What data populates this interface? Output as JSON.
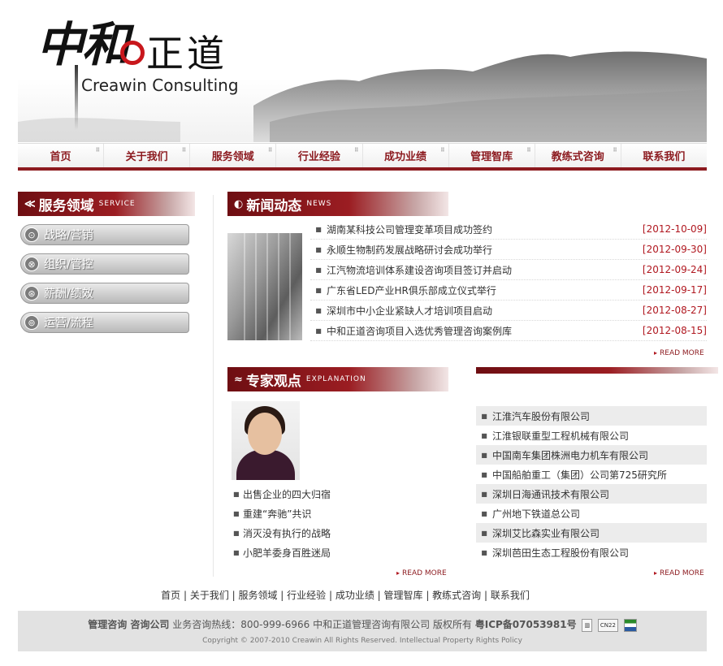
{
  "header": {
    "logo_cn_calligraphy": "中和",
    "logo_cn_text": "正道",
    "logo_en": "Creawin Consulting"
  },
  "nav": [
    "首页",
    "关于我们",
    "服务领域",
    "行业经验",
    "成功业绩",
    "管理智库",
    "教练式咨询",
    "联系我们"
  ],
  "sidebar": {
    "title": "服务领域",
    "title_en": "SERVICE",
    "items": [
      {
        "label": "战略/营销",
        "icon": "strategy-icon"
      },
      {
        "label": "组织/管控",
        "icon": "organization-icon"
      },
      {
        "label": "薪酬/绩效",
        "icon": "compensation-icon"
      },
      {
        "label": "运营/流程",
        "icon": "process-icon"
      }
    ]
  },
  "news": {
    "title": "新闻动态",
    "title_en": "NEWS",
    "more": "READ MORE",
    "items": [
      {
        "title": "湖南某科技公司管理变革项目成功签约",
        "date": "[2012-10-09]"
      },
      {
        "title": "永顺生物制药发展战略研讨会成功举行",
        "date": "[2012-09-30]"
      },
      {
        "title": "江汽物流培训体系建设咨询项目签订并启动",
        "date": "[2012-09-24]"
      },
      {
        "title": "广东省LED产业HR俱乐部成立仪式举行",
        "date": "[2012-09-17]"
      },
      {
        "title": "深圳市中小企业紧缺人才培训项目启动",
        "date": "[2012-08-27]"
      },
      {
        "title": "中和正道咨询项目入选优秀管理咨询案例库",
        "date": "[2012-08-15]"
      }
    ]
  },
  "expert": {
    "title": "专家观点",
    "title_en": "EXPLANATION",
    "more": "READ MORE",
    "items": [
      "出售企业的四大归宿",
      "重建“奔驰”共识",
      "消灭没有执行的战略",
      "小肥羊委身百胜迷局"
    ]
  },
  "clients": {
    "more": "READ MORE",
    "items": [
      "江淮汽车股份有限公司",
      "江淮银联重型工程机械有限公司",
      "中国南车集团株洲电力机车有限公司",
      "中国船舶重工（集团）公司第725研究所",
      "深圳日海通讯技术有限公司",
      "广州地下铁道总公司",
      "深圳艾比森实业有限公司",
      "深圳芭田生态工程股份有限公司"
    ]
  },
  "footer": {
    "links": "首页 | 关于我们 | 服务领域 | 行业经验 | 成功业绩 | 管理智库 | 教练式咨询 | 联系我们",
    "line1_a": "管理咨询 咨询公司",
    "line1_b": "业务咨询热线：800-999-6966 中和正道管理咨询有限公司 版权所有",
    "line1_c": "粤ICP备07053981号",
    "badge": "CN22",
    "copyright": "Copyright © 2007-2010 Creawin All Rights Reserved. Intellectual Property Rights Policy"
  },
  "colors": {
    "brand_red": "#8c1a1f",
    "date_red": "#b01820"
  }
}
